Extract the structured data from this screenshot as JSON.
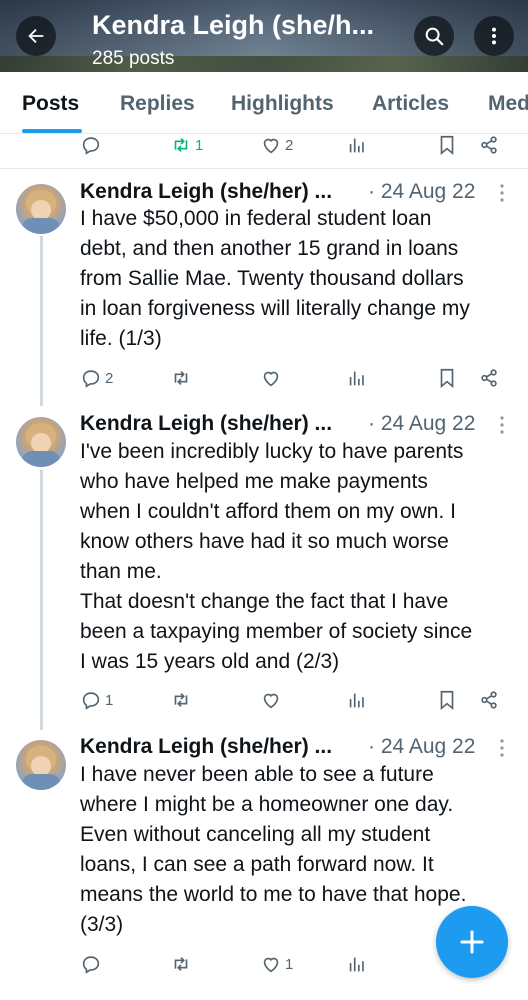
{
  "header": {
    "title": "Kendra Leigh (she/h...",
    "subtitle": "285 posts",
    "icons": [
      "back-arrow-icon",
      "search-icon",
      "more-vertical-icon"
    ]
  },
  "tabs": [
    {
      "label": "Posts",
      "active": true
    },
    {
      "label": "Replies",
      "active": false
    },
    {
      "label": "Highlights",
      "active": false
    },
    {
      "label": "Articles",
      "active": false
    },
    {
      "label": "Med",
      "active": false
    }
  ],
  "top_actions": {
    "reply_count": "",
    "repost_count": "1",
    "like_count": "2"
  },
  "posts": [
    {
      "author": "Kendra Leigh (she/her) ...",
      "date": "· 24 Aug 22",
      "text": "I have $50,000 in federal student loan\ndebt, and then another 15 grand in loans\nfrom Sallie Mae. Twenty thousand dollars\nin loan forgiveness will literally change my\nlife. (1/3)",
      "reply_count": "2",
      "repost_count": "",
      "like_count": ""
    },
    {
      "author": "Kendra Leigh (she/her) ...",
      "date": "· 24 Aug 22",
      "text": "I've been incredibly lucky to have parents\nwho have helped me make payments\nwhen I couldn't afford them on my own. I\nknow others have had it so much worse\nthan me.\nThat doesn't change the fact that I have\nbeen a taxpaying member of society since\nI was 15 years old and (2/3)",
      "reply_count": "1",
      "repost_count": "",
      "like_count": ""
    },
    {
      "author": "Kendra Leigh (she/her) ...",
      "date": "· 24 Aug 22",
      "text": "I have never been able to see a future\nwhere I might be a homeowner one day.\nEven without canceling all my student\nloans, I can see a path forward now. It\nmeans the world to me to have that hope.\n(3/3)",
      "reply_count": "",
      "repost_count": "",
      "like_count": "1"
    }
  ],
  "colors": {
    "accent": "#1d9bf0",
    "repost_active": "#00ba7c",
    "muted": "#536471",
    "text": "#0f1419"
  }
}
